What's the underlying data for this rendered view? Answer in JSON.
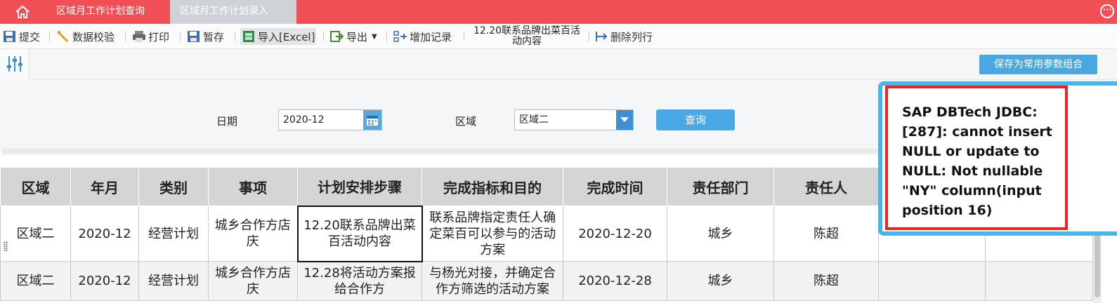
{
  "tabs": [
    {
      "label": "区域月工作计划查询",
      "active": false
    },
    {
      "label": "区域月工作计划录入",
      "active": true
    }
  ],
  "toolbar": {
    "submit": "提交",
    "validate": "数据校验",
    "print": "打印",
    "save_draft": "暂存",
    "import_excel": "导入[Excel]",
    "export": "导出",
    "add_record": "增加记录",
    "current_cell": "12.20联系品牌出菜百活动内容",
    "delete_column": "删除列行"
  },
  "filter_bar": {
    "save_combo": "保存为常用参数组合"
  },
  "query": {
    "date_label": "日期",
    "date_value": "2020-12",
    "region_label": "区域",
    "region_value": "区域二",
    "query_button": "查询"
  },
  "grid": {
    "columns": [
      "区域",
      "年月",
      "类别",
      "事项",
      "计划安排步骤",
      "完成指标和目的",
      "完成时间",
      "责任部门",
      "责任人",
      "",
      ""
    ],
    "rows": [
      {
        "region": "区域二",
        "month": "2020-12",
        "category": "经营计划",
        "item": "城乡合作方店庆",
        "steps": "12.20联系品牌出菜百活动内容",
        "goal": "联系品牌指定责任人确定菜百可以参与的活动方案",
        "done_time": "2020-12-20",
        "dept": "城乡",
        "owner": "陈超"
      },
      {
        "region": "区域二",
        "month": "2020-12",
        "category": "经营计划",
        "item": "城乡合作方店庆",
        "steps": "12.28将活动方案报给合作方",
        "goal": "与杨光对接，并确定合作方筛选的活动方案",
        "done_time": "2020-12-28",
        "dept": "城乡",
        "owner": "陈超"
      }
    ]
  },
  "error": {
    "message": "SAP DBTech JDBC: [287]: cannot insert NULL or update to NULL: Not nullable \"NY\" column(input position 16)"
  },
  "colors": {
    "topbar": "#f05055",
    "accent": "#4aa8e6",
    "error_border": "#ee2222",
    "popup_border": "#47b6e6"
  }
}
